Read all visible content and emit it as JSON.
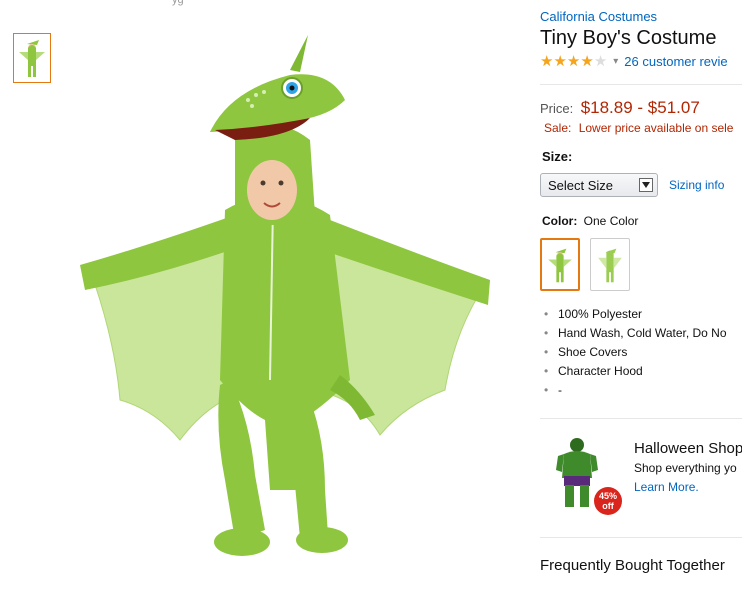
{
  "top_fragment": "yg",
  "product": {
    "brand": "California Costumes",
    "title": "Tiny Boy's Costume",
    "rating": {
      "stars": 4,
      "max": 5,
      "reviews_text": "26 customer revie"
    }
  },
  "price": {
    "label": "Price:",
    "value": "$18.89 - $51.07",
    "sale_label": "Sale:",
    "sale_text": "Lower price available on sele"
  },
  "size": {
    "label": "Size:",
    "select_value": "Select Size",
    "sizing_info": "Sizing info"
  },
  "color": {
    "label": "Color:",
    "value": "One Color"
  },
  "features": [
    "100% Polyester",
    "Hand Wash, Cold Water, Do No",
    "Shoe Covers",
    "Character Hood",
    "-"
  ],
  "bullet_glyph": "•",
  "promo": {
    "title": "Halloween Shop",
    "subtitle": "Shop everything yo",
    "link": "Learn More.",
    "badge_percent": "45%",
    "badge_off": "off"
  },
  "frequently_bought": "Frequently Bought Together",
  "colors": {
    "link": "#0066c0",
    "price": "#b12704",
    "selected_border": "#e47911",
    "star": "#f4a41d",
    "costume_green": "#8ec63f"
  }
}
